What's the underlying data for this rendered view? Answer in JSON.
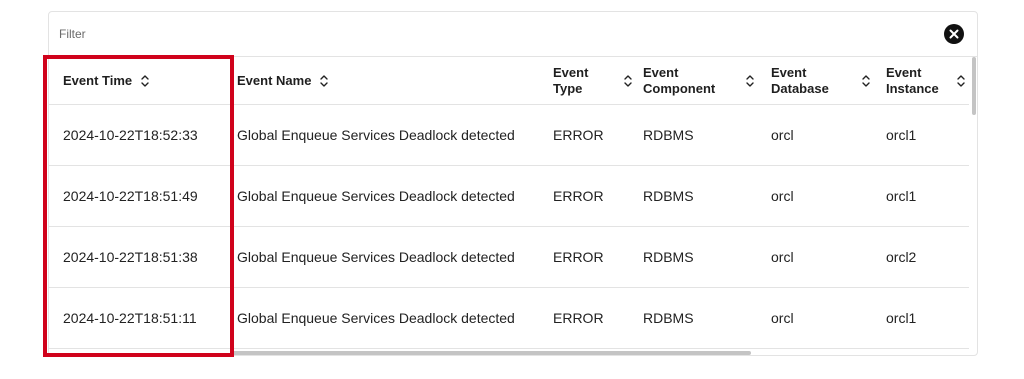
{
  "filter": {
    "label": "Filter",
    "clear_icon": "close-circle-icon"
  },
  "table": {
    "columns": [
      {
        "key": "time",
        "label": "Event Time",
        "sort_icon": "sort-updown-icon"
      },
      {
        "key": "name",
        "label": "Event Name",
        "sort_icon": "sort-updown-icon"
      },
      {
        "key": "type",
        "label": "Event Type",
        "sort_icon": "sort-updown-icon"
      },
      {
        "key": "component",
        "label": "Event Component",
        "sort_icon": "sort-updown-icon"
      },
      {
        "key": "database",
        "label": "Event Database",
        "sort_icon": "sort-updown-icon"
      },
      {
        "key": "instance",
        "label": "Event Instance",
        "sort_icon": "sort-updown-icon"
      }
    ],
    "rows": [
      {
        "time": "2024-10-22T18:52:33",
        "name": "Global Enqueue Services Deadlock detected",
        "type": "ERROR",
        "component": "RDBMS",
        "database": "orcl",
        "instance": "orcl1"
      },
      {
        "time": "2024-10-22T18:51:49",
        "name": "Global Enqueue Services Deadlock detected",
        "type": "ERROR",
        "component": "RDBMS",
        "database": "orcl",
        "instance": "orcl1"
      },
      {
        "time": "2024-10-22T18:51:38",
        "name": "Global Enqueue Services Deadlock detected",
        "type": "ERROR",
        "component": "RDBMS",
        "database": "orcl",
        "instance": "orcl2"
      },
      {
        "time": "2024-10-22T18:51:11",
        "name": "Global Enqueue Services Deadlock detected",
        "type": "ERROR",
        "component": "RDBMS",
        "database": "orcl",
        "instance": "orcl1"
      }
    ]
  },
  "highlight": {
    "color": "#d0021b",
    "target": "Event Time column"
  }
}
